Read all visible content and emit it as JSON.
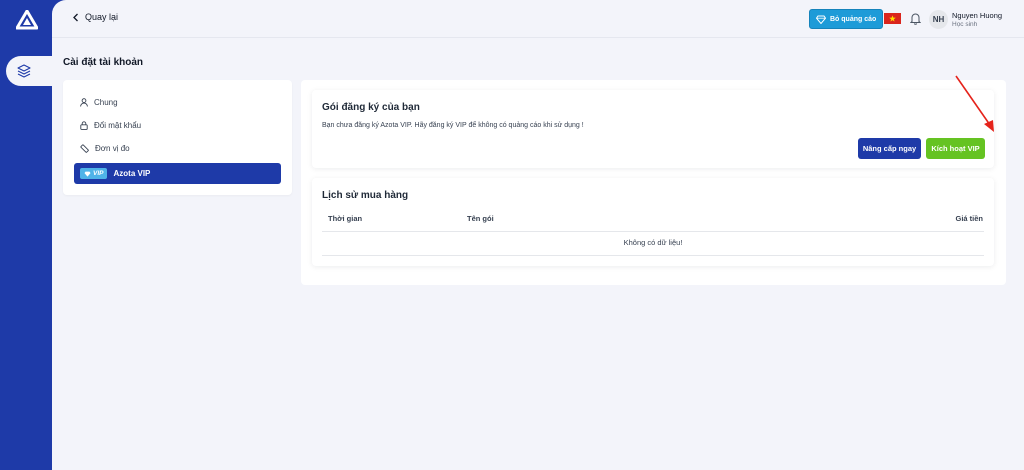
{
  "header": {
    "back_label": "Quay lại",
    "ads_button_label": "Bỏ quảng cáo",
    "user_initials": "NH",
    "user_name": "Nguyen Huong",
    "user_role": "Học sinh"
  },
  "page_title": "Cài đặt tài khoản",
  "menu": {
    "items": [
      {
        "label": "Chung",
        "icon": "user-icon"
      },
      {
        "label": "Đổi mật khẩu",
        "icon": "lock-icon"
      },
      {
        "label": "Đơn vị đo",
        "icon": "ruler-icon"
      }
    ],
    "active_badge": "VIP",
    "active_label": "Azota VIP"
  },
  "subscription": {
    "title": "Gói đăng ký của bạn",
    "description": "Bạn chưa đăng ký Azota VIP. Hãy đăng ký VIP để không có quảng cáo khi sử dụng !",
    "upgrade_label": "Nâng cấp ngay",
    "activate_label": "Kích hoạt VIP"
  },
  "history": {
    "title": "Lịch sử mua hàng",
    "columns": [
      "Thời gian",
      "Tên gói",
      "Giá tiền"
    ],
    "empty_text": "Không có dữ liệu!"
  },
  "colors": {
    "brand": "#1e3aa8",
    "activate": "#65c322",
    "ads": "#1d9bd8",
    "annotation_arrow": "#e5231b"
  }
}
